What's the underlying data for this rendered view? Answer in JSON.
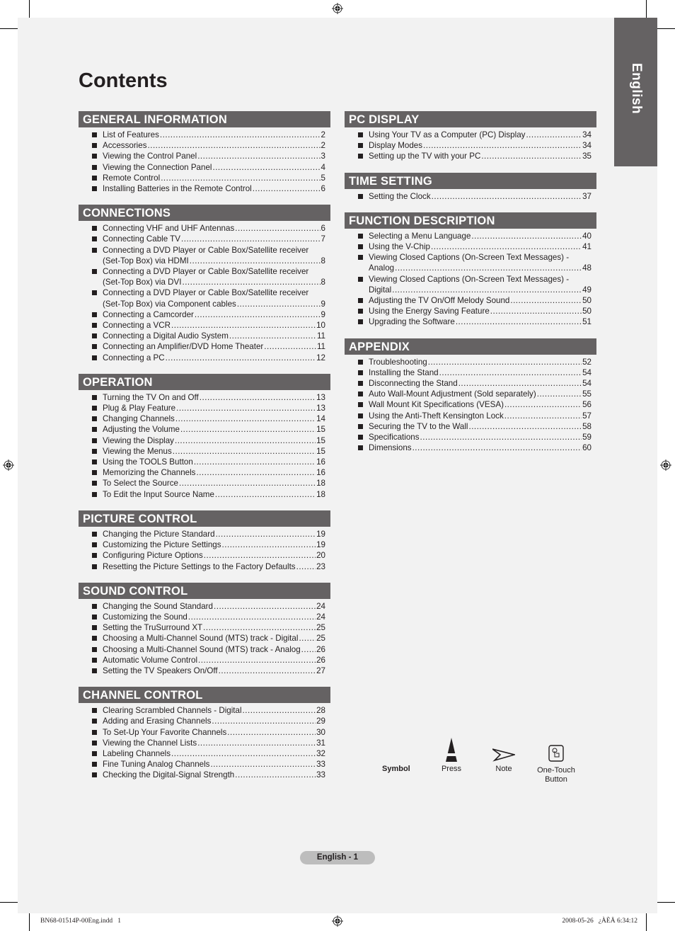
{
  "title": "Contents",
  "language_tab": "English",
  "left_sections": [
    {
      "heading": "GENERAL INFORMATION",
      "items": [
        {
          "lines": [
            "List of Features"
          ],
          "page": "2"
        },
        {
          "lines": [
            "Accessories"
          ],
          "page": "2"
        },
        {
          "lines": [
            "Viewing the Control Panel"
          ],
          "page": "3"
        },
        {
          "lines": [
            "Viewing the Connection Panel"
          ],
          "page": "4"
        },
        {
          "lines": [
            "Remote Control"
          ],
          "page": "5"
        },
        {
          "lines": [
            "Installing Batteries in the Remote Control"
          ],
          "page": "6"
        }
      ]
    },
    {
      "heading": "CONNECTIONS",
      "items": [
        {
          "lines": [
            "Connecting VHF and UHF Antennas"
          ],
          "page": "6"
        },
        {
          "lines": [
            "Connecting Cable TV"
          ],
          "page": "7"
        },
        {
          "lines": [
            "Connecting a DVD Player or Cable Box/Satellite receiver",
            "(Set-Top Box) via HDMI"
          ],
          "page": "8"
        },
        {
          "lines": [
            "Connecting a DVD Player or Cable Box/Satellite receiver",
            "(Set-Top Box) via DVI"
          ],
          "page": "8"
        },
        {
          "lines": [
            "Connecting a DVD Player or Cable Box/Satellite receiver",
            "(Set-Top Box) via Component cables"
          ],
          "page": "9"
        },
        {
          "lines": [
            "Connecting a Camcorder"
          ],
          "page": "9"
        },
        {
          "lines": [
            "Connecting a VCR"
          ],
          "page": "10"
        },
        {
          "lines": [
            "Connecting a Digital Audio System"
          ],
          "page": "11"
        },
        {
          "lines": [
            "Connecting an Amplifier/DVD Home Theater"
          ],
          "page": "11"
        },
        {
          "lines": [
            "Connecting a PC"
          ],
          "page": "12"
        }
      ]
    },
    {
      "heading": "OPERATION",
      "items": [
        {
          "lines": [
            "Turning the TV On and Off"
          ],
          "page": "13"
        },
        {
          "lines": [
            "Plug & Play Feature"
          ],
          "page": "13"
        },
        {
          "lines": [
            "Changing Channels"
          ],
          "page": "14"
        },
        {
          "lines": [
            "Adjusting the Volume"
          ],
          "page": "15"
        },
        {
          "lines": [
            "Viewing the Display"
          ],
          "page": "15"
        },
        {
          "lines": [
            "Viewing the Menus"
          ],
          "page": "15"
        },
        {
          "lines": [
            "Using the TOOLS Button"
          ],
          "page": "16"
        },
        {
          "lines": [
            "Memorizing the Channels"
          ],
          "page": "16"
        },
        {
          "lines": [
            "To Select the Source"
          ],
          "page": "18"
        },
        {
          "lines": [
            "To Edit the Input Source Name"
          ],
          "page": "18"
        }
      ]
    },
    {
      "heading": "PICTURE CONTROL",
      "items": [
        {
          "lines": [
            "Changing the Picture Standard"
          ],
          "page": "19"
        },
        {
          "lines": [
            "Customizing the Picture Settings"
          ],
          "page": "19"
        },
        {
          "lines": [
            "Configuring Picture Options"
          ],
          "page": "20"
        },
        {
          "lines": [
            "Resetting the Picture Settings to the Factory Defaults"
          ],
          "page": "23"
        }
      ]
    },
    {
      "heading": "SOUND CONTROL",
      "items": [
        {
          "lines": [
            "Changing the Sound Standard"
          ],
          "page": "24"
        },
        {
          "lines": [
            "Customizing the Sound"
          ],
          "page": "24"
        },
        {
          "lines": [
            "Setting the TruSurround XT"
          ],
          "page": "25"
        },
        {
          "lines": [
            "Choosing a Multi-Channel Sound (MTS) track - Digital"
          ],
          "page": "25"
        },
        {
          "lines": [
            "Choosing a Multi-Channel Sound (MTS) track - Analog"
          ],
          "page": "26"
        },
        {
          "lines": [
            "Automatic Volume Control"
          ],
          "page": "26"
        },
        {
          "lines": [
            "Setting the TV Speakers On/Off"
          ],
          "page": "27"
        }
      ]
    },
    {
      "heading": "CHANNEL CONTROL",
      "items": [
        {
          "lines": [
            "Clearing Scrambled Channels - Digital"
          ],
          "page": "28"
        },
        {
          "lines": [
            "Adding and Erasing Channels"
          ],
          "page": "29"
        },
        {
          "lines": [
            "To Set-Up Your Favorite Channels"
          ],
          "page": "30"
        },
        {
          "lines": [
            "Viewing the Channel Lists"
          ],
          "page": "31"
        },
        {
          "lines": [
            "Labeling Channels"
          ],
          "page": "32"
        },
        {
          "lines": [
            "Fine Tuning Analog Channels"
          ],
          "page": "33"
        },
        {
          "lines": [
            "Checking the Digital-Signal Strength"
          ],
          "page": "33"
        }
      ]
    }
  ],
  "right_sections": [
    {
      "heading": "PC DISPLAY",
      "items": [
        {
          "lines": [
            "Using Your TV as a Computer (PC) Display"
          ],
          "page": "34"
        },
        {
          "lines": [
            "Display Modes"
          ],
          "page": "34"
        },
        {
          "lines": [
            "Setting up the TV with your PC"
          ],
          "page": "35"
        }
      ]
    },
    {
      "heading": "TIME SETTING",
      "items": [
        {
          "lines": [
            "Setting the Clock"
          ],
          "page": "37"
        }
      ]
    },
    {
      "heading": "FUNCTION DESCRIPTION",
      "items": [
        {
          "lines": [
            "Selecting a Menu Language"
          ],
          "page": "40"
        },
        {
          "lines": [
            "Using the V-Chip"
          ],
          "page": "41"
        },
        {
          "lines": [
            "Viewing Closed Captions (On-Screen Text Messages) -",
            "Analog"
          ],
          "page": "48"
        },
        {
          "lines": [
            "Viewing Closed Captions (On-Screen Text Messages) -",
            "Digital"
          ],
          "page": "49"
        },
        {
          "lines": [
            "Adjusting the TV On/Off Melody Sound"
          ],
          "page": "50"
        },
        {
          "lines": [
            "Using the Energy Saving Feature"
          ],
          "page": "50"
        },
        {
          "lines": [
            "Upgrading the Software"
          ],
          "page": "51"
        }
      ]
    },
    {
      "heading": "APPENDIX",
      "items": [
        {
          "lines": [
            "Troubleshooting"
          ],
          "page": "52"
        },
        {
          "lines": [
            "Installing the Stand"
          ],
          "page": "54"
        },
        {
          "lines": [
            "Disconnecting the Stand"
          ],
          "page": "54"
        },
        {
          "lines": [
            "Auto Wall-Mount Adjustment (Sold separately)"
          ],
          "page": "55"
        },
        {
          "lines": [
            "Wall Mount Kit Specifications (VESA)"
          ],
          "page": "56"
        },
        {
          "lines": [
            "Using the Anti-Theft Kensington Lock"
          ],
          "page": "57"
        },
        {
          "lines": [
            "Securing the TV to the Wall"
          ],
          "page": "58"
        },
        {
          "lines": [
            "Specifications"
          ],
          "page": "59"
        },
        {
          "lines": [
            "Dimensions"
          ],
          "page": "60"
        }
      ]
    }
  ],
  "symbols": {
    "heading": "Symbol",
    "press": {
      "label": "Press",
      "icon": "press-icon"
    },
    "note": {
      "label": "Note",
      "icon": "note-arrow-icon"
    },
    "one_touch": {
      "label_line1": "One-Touch",
      "label_line2": "Button",
      "icon": "one-touch-button-icon"
    }
  },
  "footer": {
    "page_label": "English - 1",
    "file_slug": "BN68-01514P-00Eng.indd   1",
    "timestamp": "2008-05-26   ¿ÀÈÄ 6:34:12"
  }
}
